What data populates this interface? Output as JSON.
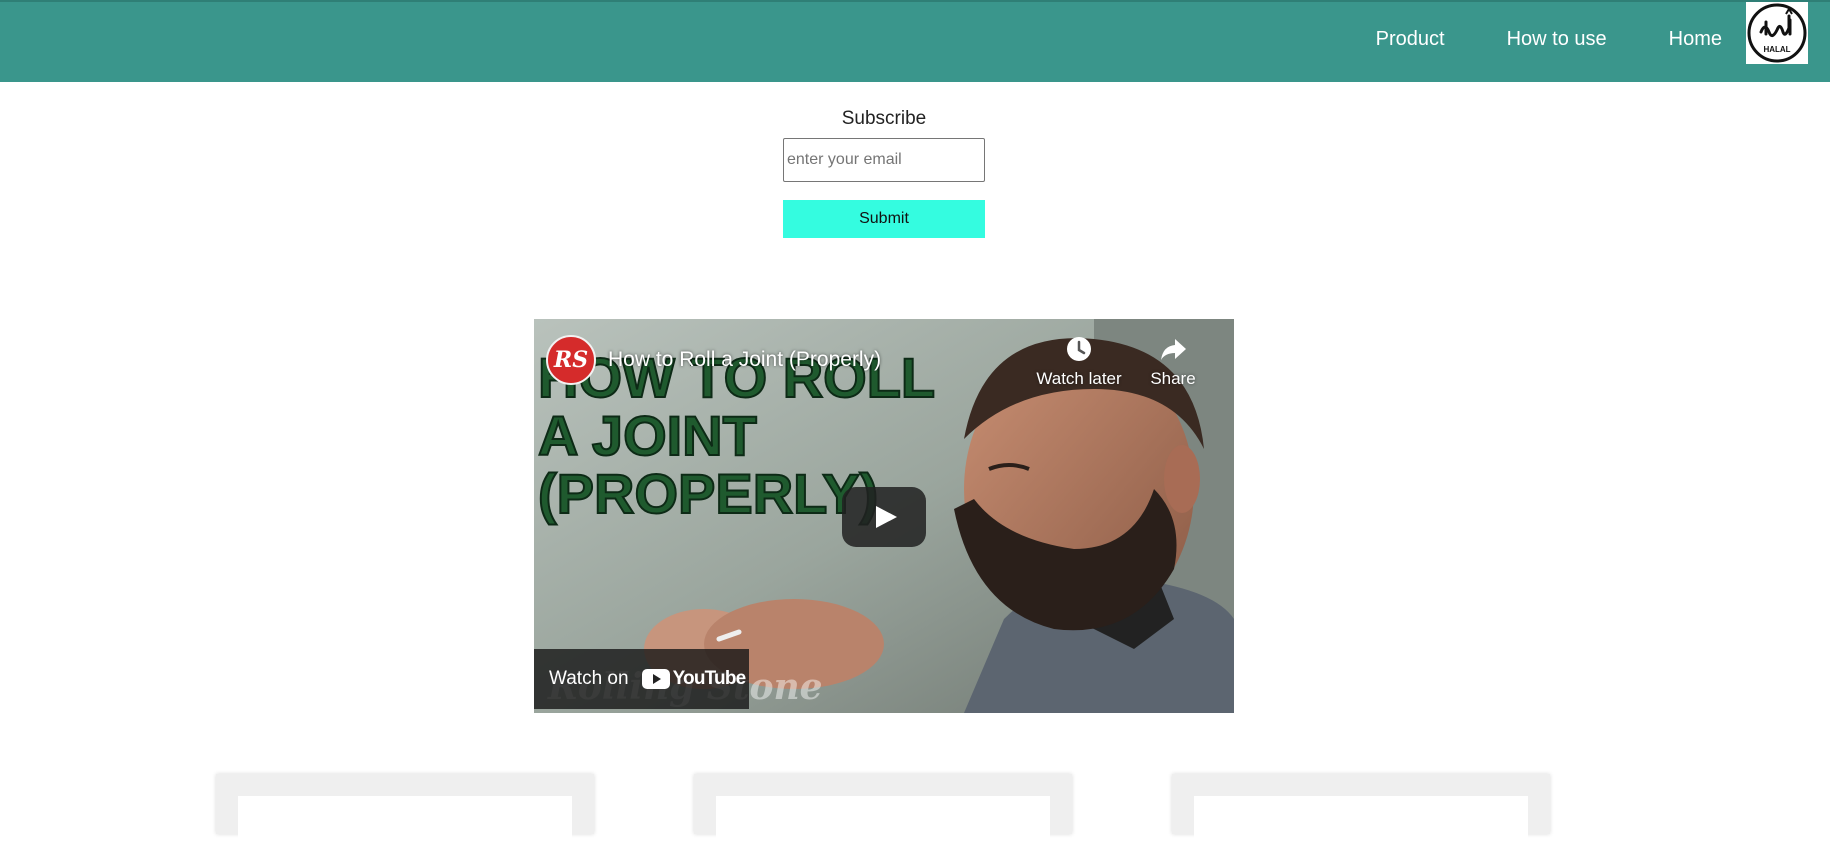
{
  "nav": {
    "links": [
      "Product",
      "How to use",
      "Home"
    ],
    "logo_text": "HALAL",
    "background": "#3a968c"
  },
  "subscribe": {
    "title": "Subscribe",
    "email_placeholder": "enter your email",
    "email_value": "",
    "submit_label": "Submit",
    "button_color": "#34fce0"
  },
  "video": {
    "title": "How to Roll a Joint (Properly)",
    "channel_avatar_text": "RS",
    "watch_later_label": "Watch later",
    "share_label": "Share",
    "watch_on_label": "Watch on",
    "youtube_label": "YouTube",
    "thumbnail_text": [
      "HOW TO ROLL",
      "A JOINT",
      "(PROPERLY)"
    ],
    "icons": [
      "clock-icon",
      "share-icon",
      "play-icon",
      "youtube-icon"
    ]
  },
  "cards": [
    {},
    {},
    {}
  ]
}
